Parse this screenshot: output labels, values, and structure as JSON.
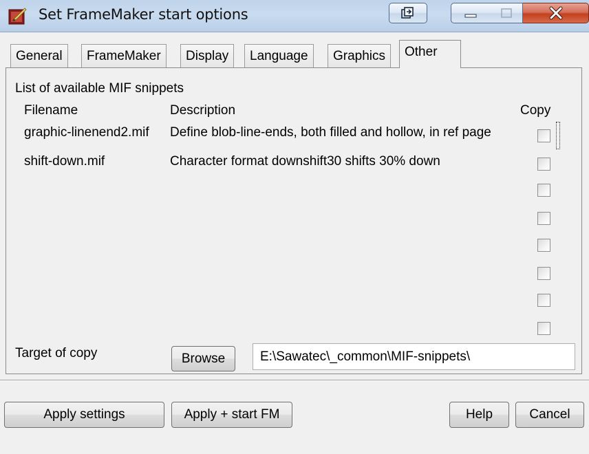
{
  "window": {
    "title": "Set FrameMaker start options",
    "icon": "framemaker-app-icon"
  },
  "tabs": [
    {
      "label": "General",
      "active": false
    },
    {
      "label": "FrameMaker",
      "active": false
    },
    {
      "label": "Display",
      "active": false
    },
    {
      "label": "Language",
      "active": false
    },
    {
      "label": "Graphics",
      "active": false
    },
    {
      "label": "Other",
      "active": true
    }
  ],
  "other": {
    "section_label": "List of available MIF snippets",
    "columns": {
      "filename": "Filename",
      "description": "Description",
      "copy": "Copy"
    },
    "rows": [
      {
        "filename": "graphic-linenend2.mif",
        "description": "Define blob-line-ends, both filled and hollow, in ref page",
        "copy": false
      },
      {
        "filename": "shift-down.mif",
        "description": "Character format downshift30 shifts 30% down",
        "copy": false
      },
      {
        "filename": "",
        "description": "",
        "copy": false
      },
      {
        "filename": "",
        "description": "",
        "copy": false
      },
      {
        "filename": "",
        "description": "",
        "copy": false
      },
      {
        "filename": "",
        "description": "",
        "copy": false
      },
      {
        "filename": "",
        "description": "",
        "copy": false
      },
      {
        "filename": "",
        "description": "",
        "copy": false
      }
    ],
    "target_label": "Target of copy",
    "browse_label": "Browse",
    "target_path": "E:\\Sawatec\\_common\\MIF-snippets\\"
  },
  "buttons": {
    "apply_settings": "Apply settings",
    "apply_start": "Apply + start FM",
    "help": "Help",
    "cancel": "Cancel"
  },
  "colors": {
    "titlebar": "#c4d7ed",
    "close_button": "#c9452a",
    "dialog_bg": "#f0f0f0"
  }
}
